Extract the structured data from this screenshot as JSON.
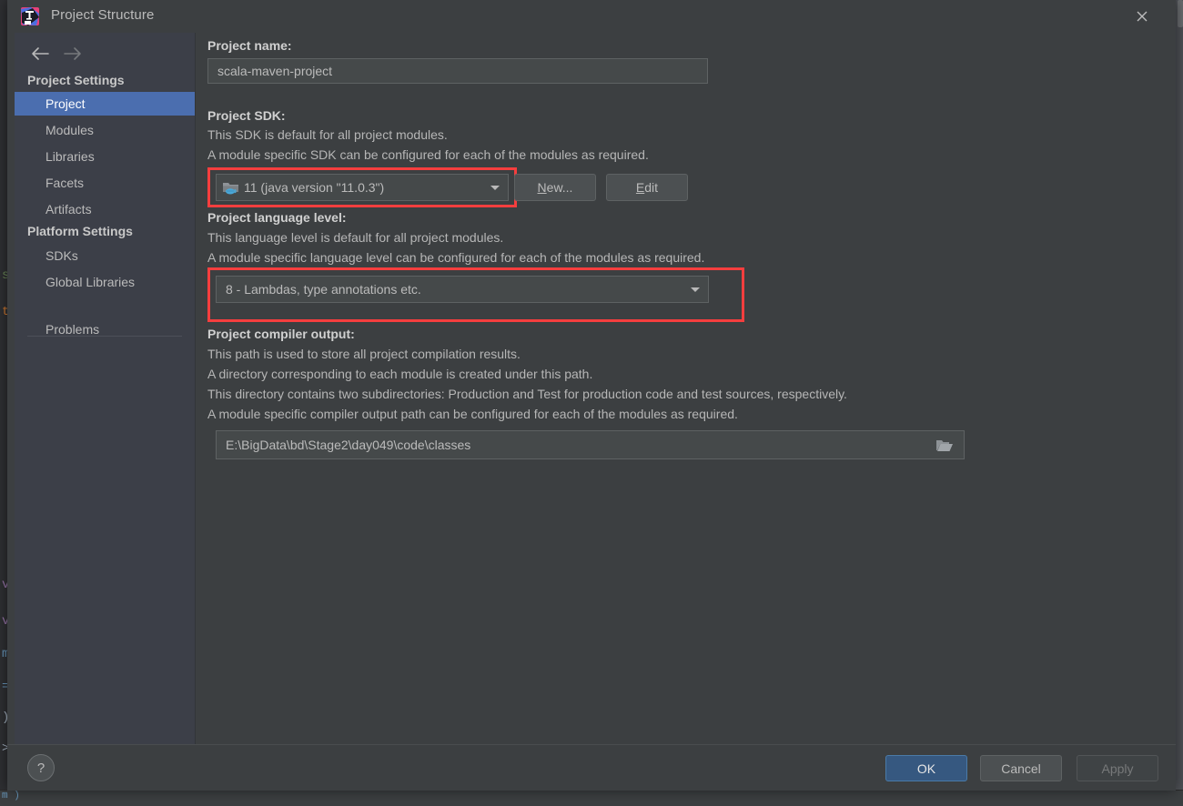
{
  "window": {
    "title": "Project Structure",
    "logo_icon": "intellij-idea-logo",
    "close_icon": "close-icon"
  },
  "sidebar": {
    "back_icon": "arrow-left-icon",
    "forward_icon": "arrow-right-icon",
    "groups": [
      {
        "title": "Project Settings",
        "items": [
          {
            "label": "Project",
            "selected": true
          },
          {
            "label": "Modules",
            "selected": false
          },
          {
            "label": "Libraries",
            "selected": false
          },
          {
            "label": "Facets",
            "selected": false
          },
          {
            "label": "Artifacts",
            "selected": false
          }
        ]
      },
      {
        "title": "Platform Settings",
        "items": [
          {
            "label": "SDKs",
            "selected": false
          },
          {
            "label": "Global Libraries",
            "selected": false
          }
        ]
      }
    ],
    "extra_items": [
      {
        "label": "Problems",
        "selected": false
      }
    ]
  },
  "main": {
    "project_name": {
      "label": "Project name:",
      "value": "scala-maven-project"
    },
    "project_sdk": {
      "label": "Project SDK:",
      "description_lines": [
        "This SDK is default for all project modules.",
        "A module specific SDK can be configured for each of the modules as required."
      ],
      "selected": "11 (java version \"11.0.3\")",
      "selected_version": "11",
      "selected_detail": "(java version \"11.0.3\")",
      "icon": "java-sdk-folder-icon",
      "dropdown_icon": "chevron-down-icon",
      "new_button": "New...",
      "new_button_mnemonic": "N",
      "edit_button": "Edit",
      "edit_button_mnemonic": "E",
      "highlighted": true
    },
    "language_level": {
      "label": "Project language level:",
      "description_lines": [
        "This language level is default for all project modules.",
        "A module specific language level can be configured for each of the modules as required."
      ],
      "selected": "8 - Lambdas, type annotations etc.",
      "dropdown_icon": "chevron-down-icon",
      "highlighted": true
    },
    "compiler_output": {
      "label": "Project compiler output:",
      "description_lines": [
        "This path is used to store all project compilation results.",
        "A directory corresponding to each module is created under this path.",
        "This directory contains two subdirectories: Production and Test for production code and test sources, respectively.",
        "A module specific compiler output path can be configured for each of the modules as required."
      ],
      "value": "E:\\BigData\\bd\\Stage2\\day049\\code\\classes",
      "browse_icon": "folder-browse-icon"
    }
  },
  "footer": {
    "help_label": "?",
    "help_icon": "help-icon",
    "ok_label": "OK",
    "cancel_label": "Cancel",
    "apply_label": "Apply",
    "apply_enabled": false
  },
  "colors": {
    "dialog_background": "#3c3f41",
    "sidebar_background": "#3c3f48",
    "selection_blue": "#4b6eaf",
    "ok_button_blue": "#365880",
    "annotation_red": "#f53e3e",
    "text_primary": "#bbbbbb",
    "text_bold": "#d0d0d0"
  },
  "background_editor": {
    "left_chars": [
      "s",
      "t",
      "v",
      "v",
      "m",
      "=",
      ")",
      ">"
    ],
    "bottom_text": "m )"
  }
}
